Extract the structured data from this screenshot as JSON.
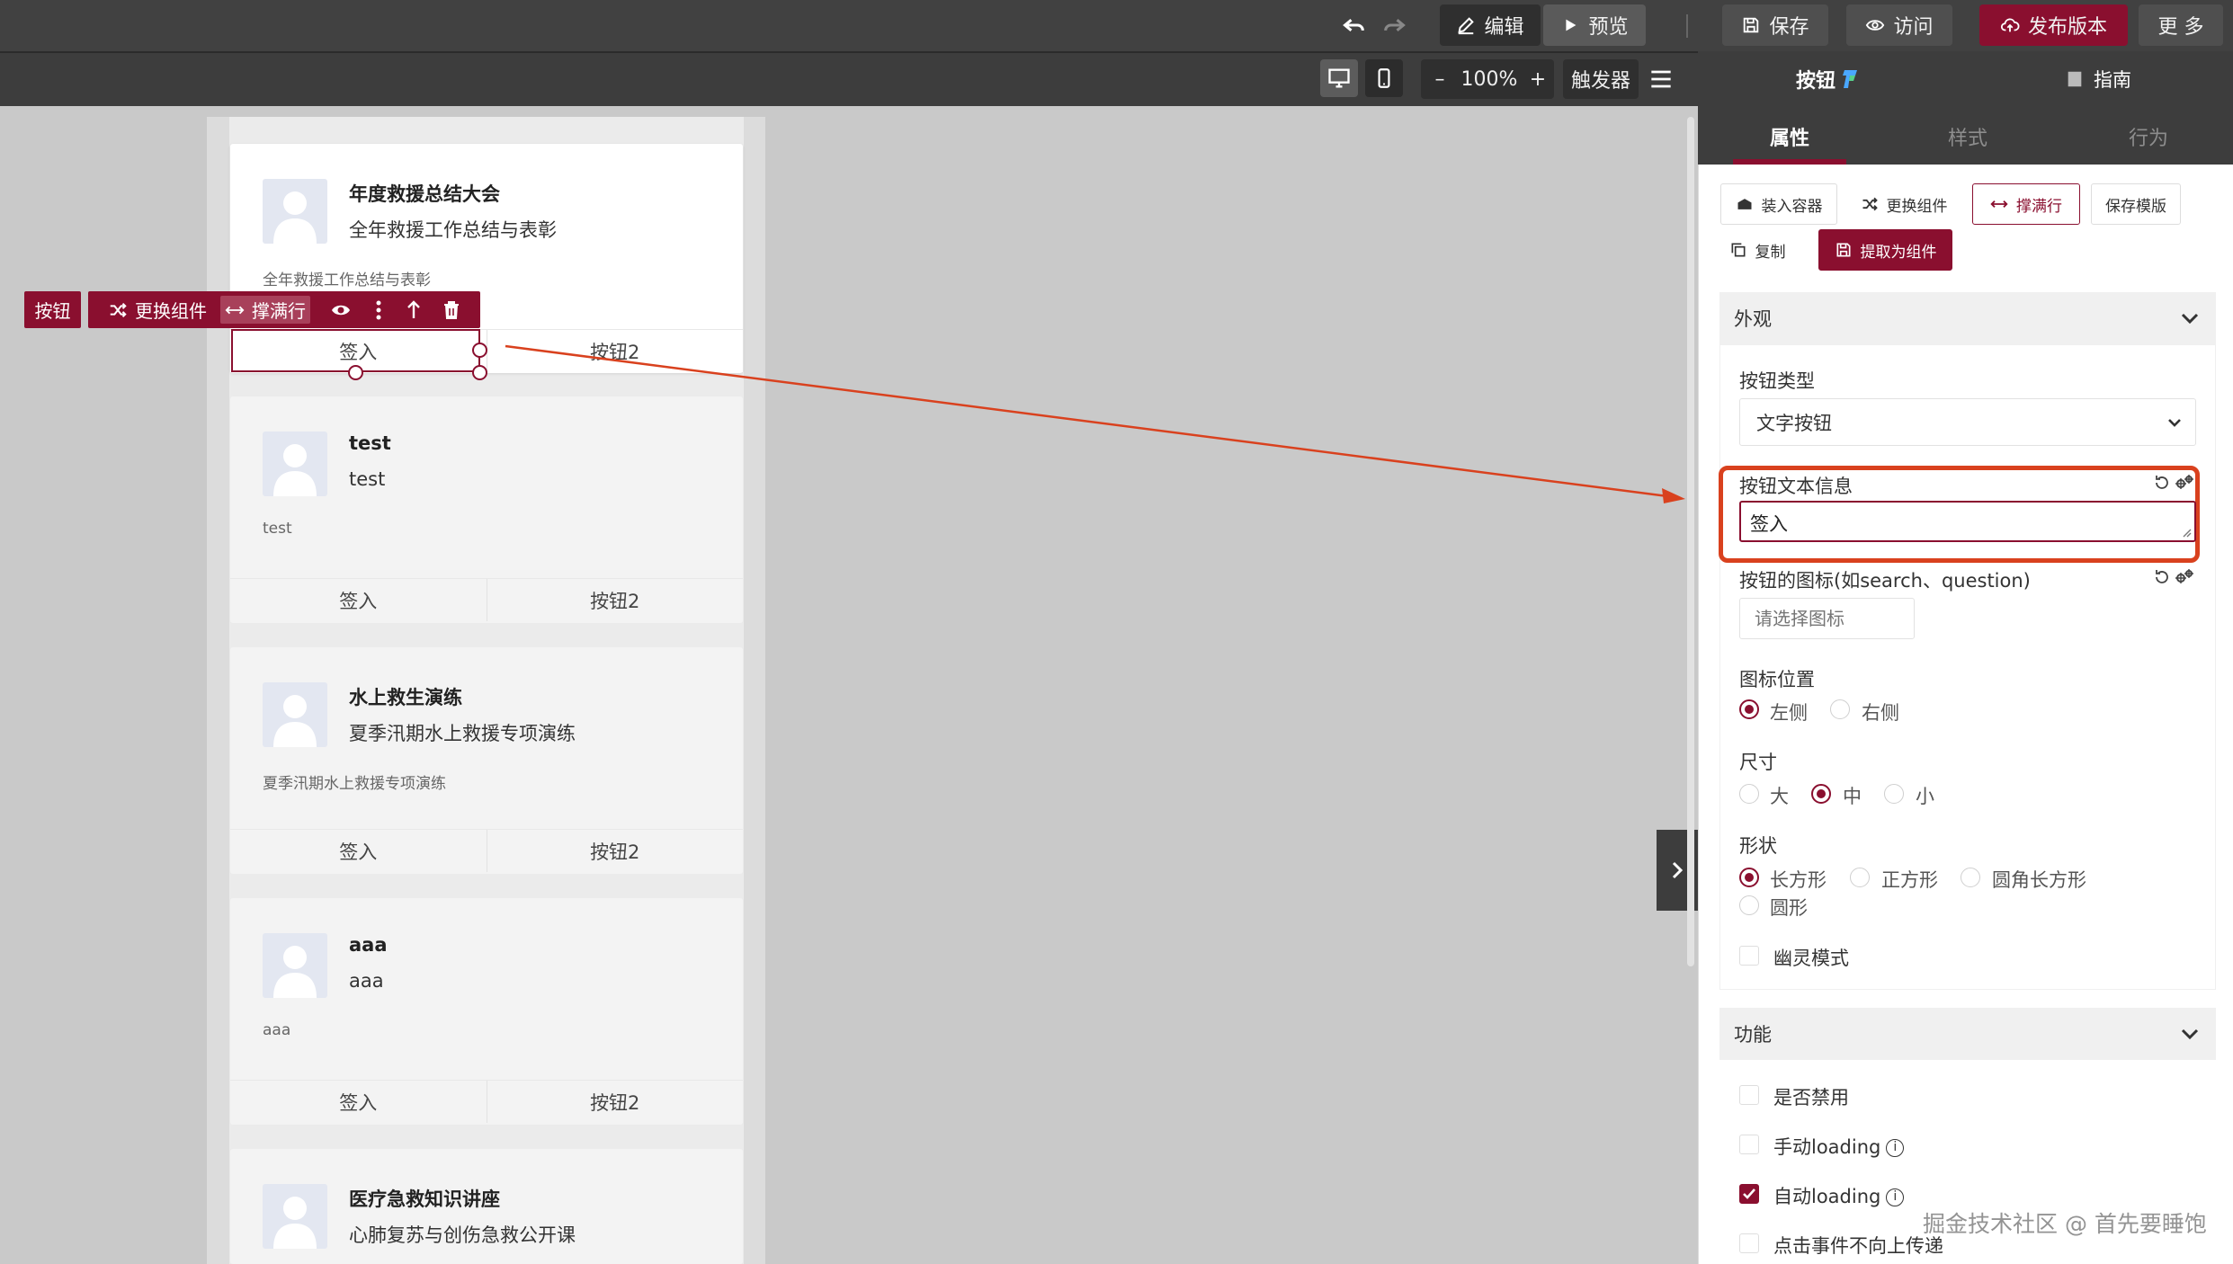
{
  "topbar": {
    "edit_label": "编辑",
    "preview_label": "预览",
    "save_label": "保存",
    "visit_label": "访问",
    "publish_label": "发布版本",
    "more_label": "更 多"
  },
  "secbar": {
    "zoom_minus": "–",
    "zoom_value": "100%",
    "zoom_plus": "+",
    "trigger_label": "触发器"
  },
  "cards": [
    {
      "title": "年度救援总结大会",
      "subtitle": "全年救援工作总结与表彰",
      "desc": "全年救援工作总结与表彰",
      "btn1": "签入",
      "btn2": "按钮2"
    },
    {
      "title": "test",
      "subtitle": "test",
      "desc": "test",
      "btn1": "签入",
      "btn2": "按钮2"
    },
    {
      "title": "水上救生演练",
      "subtitle": "夏季汛期水上救援专项演练",
      "desc": "夏季汛期水上救援专项演练",
      "btn1": "签入",
      "btn2": "按钮2"
    },
    {
      "title": "aaa",
      "subtitle": "aaa",
      "desc": "aaa",
      "btn1": "签入",
      "btn2": "按钮2"
    },
    {
      "title": "医疗急救知识讲座",
      "subtitle": "心肺复苏与创伤急救公开课"
    }
  ],
  "floating_toolbar": {
    "component_label": "按钮",
    "replace_label": "更换组件",
    "fill_row_label": "撑满行"
  },
  "panel": {
    "header_title": "按钮",
    "guide_label": "指南",
    "tabs": [
      "属性",
      "样式",
      "行为"
    ],
    "actions": {
      "wrap_container": "装入容器",
      "replace_component": "更换组件",
      "fill_row": "撑满行",
      "save_template": "保存模版",
      "copy": "复制",
      "extract_component": "提取为组件"
    },
    "appearance": {
      "section_title": "外观",
      "button_type_label": "按钮类型",
      "button_type_value": "文字按钮",
      "text_label": "按钮文本信息",
      "text_value": "签入",
      "icon_label": "按钮的图标(如search、question)",
      "icon_placeholder": "请选择图标",
      "icon_position_label": "图标位置",
      "icon_position_options": [
        "左侧",
        "右侧"
      ],
      "size_label": "尺寸",
      "size_options": [
        "大",
        "中",
        "小"
      ],
      "shape_label": "形状",
      "shape_options": [
        "长方形",
        "正方形",
        "圆角长方形",
        "圆形"
      ],
      "ghost_label": "幽灵模式"
    },
    "function": {
      "section_title": "功能",
      "disabled_label": "是否禁用",
      "manual_loading_label": "手动loading",
      "auto_loading_label": "自动loading",
      "no_propagation_label": "点击事件不向上传递"
    }
  },
  "watermark": "掘金技术社区 @ 首先要睡饱",
  "colors": {
    "accent": "#8a0f2f",
    "annotation": "#d9411e",
    "topbar": "#414141"
  }
}
